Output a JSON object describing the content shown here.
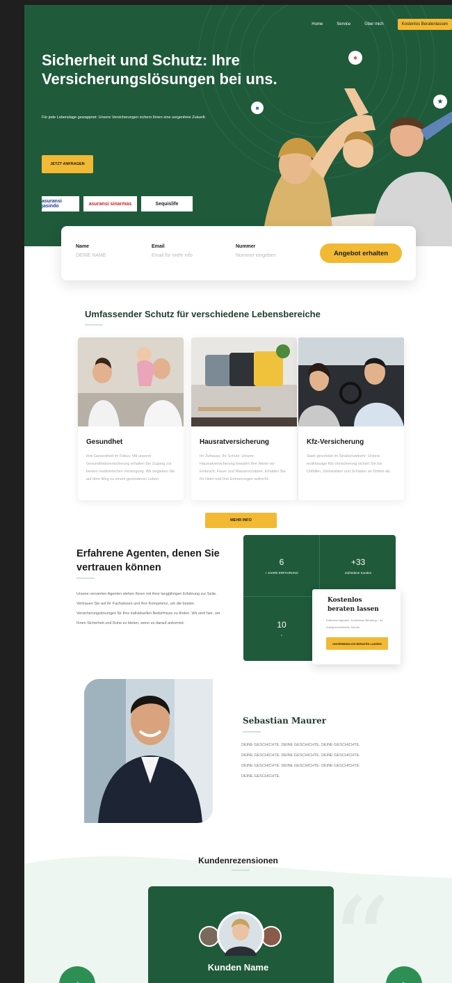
{
  "nav": {
    "items": [
      "Home",
      "Service",
      "Über mich"
    ],
    "cta": "Kostenlos Beratenlassen"
  },
  "hero": {
    "title": "Sicherheit und Schutz: Ihre Versicherungslösungen bei uns.",
    "subtitle": "Für jede Lebenslage gewappnet: Unsere Versicherungen sichern Ihnen eine sorgenfreie Zukunft.",
    "button": "JETZT ANFRAGEN",
    "partners": [
      "asuransi jasindo",
      "asuransi sinarmas",
      "Sequislife"
    ]
  },
  "form": {
    "fields": [
      {
        "label": "Name",
        "placeholder": "DEINE NAME"
      },
      {
        "label": "Email",
        "placeholder": "Email für mehr info"
      },
      {
        "label": "Nummer",
        "placeholder": "Nummer eingeben"
      }
    ],
    "submit": "Angebot erhalten"
  },
  "services": {
    "title": "Umfassender Schutz für verschiedene Lebensbereiche",
    "cards": [
      {
        "title": "Gesundhet",
        "desc": "Ihre Gesundheit im Fokus: Mit unserer Gesundheitsversicherung erhalten Sie Zugang zur besten medizinischen Versorgung. Wir begleiten Sie auf dem Weg zu einem gesünderen Leben."
      },
      {
        "title": "Hausratversicherung",
        "desc": "Ihr Zuhause, Ihr Schutz: Unsere Hausratversicherung bewahrt Ihre Werte vor Einbruch, Feuer und Wasserschäden. Erhalten Sie Ihr Heim und Ihre Erinnerungen aufrecht."
      },
      {
        "title": "Kfz-Versicherung",
        "desc": "Stark geschützt im Straßenverkehr: Unsere erstklassige Kfz-Versicherung sichert Sie bei Unfällen, Diebstählen und Schäden an Dritten ab."
      }
    ],
    "more": "MEHR INFO"
  },
  "agents": {
    "title": "Erfahrene Agenten, denen Sie vertrauen können",
    "text": "Unsere versierten Agenten stehen Ihnen mit ihrer langjährigen Erfahrung zur Seite. Vertrauen Sie auf ihr Fachwissen und ihre Kompetenz, um die besten Versicherungslösungen für Ihre individuellen Bedürfnisse zu finden. Wir sind hier, um Ihnen Sicherheit und Ruhe zu bieten, wenn es darauf ankommt.",
    "stats": [
      {
        "number": "6",
        "label": "+ JAHRE ERFAHRUNG"
      },
      {
        "number": "+33",
        "label": "Zufriedene Kunden"
      },
      {
        "number": "10",
        "label": "+"
      }
    ],
    "consult": {
      "title": "Kostenlos beraten lassen",
      "desc": "Erfahrene Agenten: Kostenlose Beratung – Ihr maßgeschneiderter Schutz.",
      "button": "UNVERBINDLICH BERATEN LASSEN"
    }
  },
  "profile": {
    "name": "Sebastian Maurer",
    "story": "DEINE GESCHICHTE. DEINE GESCHICHTE. DEINE GESCHICHTE. DEINE GESCHICHTE. DEINE GESCHICHTE. DEINE GESCHICHTE. DEINE GESCHICHTE. DEINE GESCHICHTE. DEINE GESCHICHTE. DEINE GESCHICHTE."
  },
  "reviews": {
    "title": "Kundenrezensionen",
    "customer_name": "Kunden Name"
  },
  "colors": {
    "primary_green": "#1f5a3b",
    "accent_yellow": "#f2b934"
  }
}
